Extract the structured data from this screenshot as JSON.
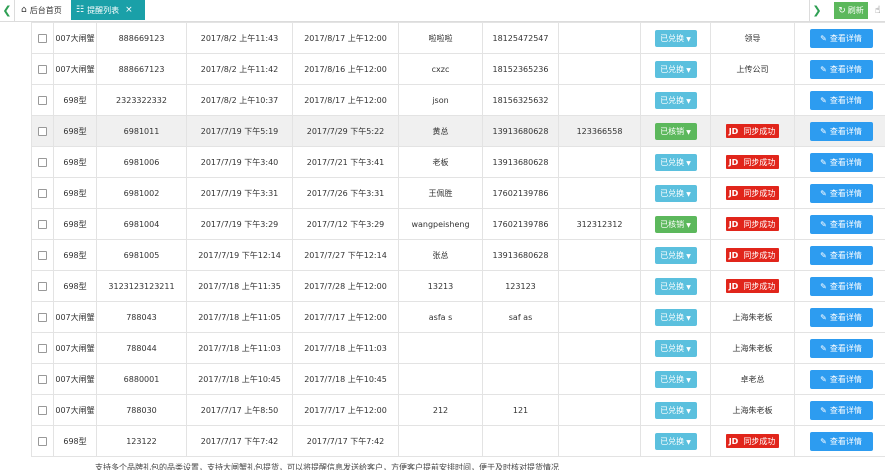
{
  "tabs": {
    "home_label": "后台首页",
    "active_label": "提醒列表",
    "close_glyph": "×",
    "prev_glyph": "❮",
    "next_glyph": "❯"
  },
  "toolbar": {
    "refresh_label": "刷新"
  },
  "status_labels": {
    "exchanged": "已兑换",
    "verified": "已核销"
  },
  "jd_badge": {
    "logo": "JD",
    "text": "同步成功"
  },
  "detail_label": "查看详情",
  "colors": {
    "accent": "#1aa0a8",
    "refresh": "#5cb85c",
    "status_blue": "#5bc0de",
    "status_green": "#5cb85c",
    "detail_blue": "#2d9cf0",
    "jd_red": "#e1251b"
  },
  "icons": {
    "home": "home-icon",
    "tab": "list-icon",
    "refresh": "refresh-icon",
    "edit": "pencil-icon",
    "side": "hand-icon"
  },
  "rows": [
    {
      "type": "007大闸蟹",
      "code": "888669123",
      "created": "2017/8/2 上午11:43",
      "remind": "2017/8/17 上午12:00",
      "name": "啦啦啦",
      "phone": "18125472547",
      "extra": "",
      "status": "已兑换",
      "note": "领导",
      "jd": false,
      "green": false
    },
    {
      "type": "007大闸蟹",
      "code": "888667123",
      "created": "2017/8/2 上午11:42",
      "remind": "2017/8/16 上午12:00",
      "name": "cxzc",
      "phone": "18152365236",
      "extra": "",
      "status": "已兑换",
      "note": "上传公司",
      "jd": false,
      "green": false
    },
    {
      "type": "698型",
      "code": "2323322332",
      "created": "2017/8/2 上午10:37",
      "remind": "2017/8/17 上午12:00",
      "name": "json",
      "phone": "18156325632",
      "extra": "",
      "status": "已兑换",
      "note": "",
      "jd": false,
      "green": false
    },
    {
      "type": "698型",
      "code": "6981011",
      "created": "2017/7/19 下午5:19",
      "remind": "2017/7/29 下午5:22",
      "name": "黄总",
      "phone": "13913680628",
      "extra": "123366558",
      "status": "已核销",
      "note": "",
      "jd": true,
      "green": true,
      "highlight": true
    },
    {
      "type": "698型",
      "code": "6981006",
      "created": "2017/7/19 下午3:40",
      "remind": "2017/7/21 下午3:41",
      "name": "老板",
      "phone": "13913680628",
      "extra": "",
      "status": "已兑换",
      "note": "",
      "jd": true,
      "green": false
    },
    {
      "type": "698型",
      "code": "6981002",
      "created": "2017/7/19 下午3:31",
      "remind": "2017/7/26 下午3:31",
      "name": "王佩胜",
      "phone": "17602139786",
      "extra": "",
      "status": "已兑换",
      "note": "",
      "jd": true,
      "green": false
    },
    {
      "type": "698型",
      "code": "6981004",
      "created": "2017/7/19 下午3:29",
      "remind": "2017/7/12 下午3:29",
      "name": "wangpeisheng",
      "phone": "17602139786",
      "extra": "312312312",
      "status": "已核销",
      "note": "",
      "jd": true,
      "green": true
    },
    {
      "type": "698型",
      "code": "6981005",
      "created": "2017/7/19 下午12:14",
      "remind": "2017/7/27 下午12:14",
      "name": "张总",
      "phone": "13913680628",
      "extra": "",
      "status": "已兑换",
      "note": "",
      "jd": true,
      "green": false
    },
    {
      "type": "698型",
      "code": "3123123123211",
      "created": "2017/7/18 上午11:35",
      "remind": "2017/7/28 上午12:00",
      "name": "13213",
      "phone": "123123",
      "extra": "",
      "status": "已兑换",
      "note": "",
      "jd": true,
      "green": false
    },
    {
      "type": "007大闸蟹",
      "code": "788043",
      "created": "2017/7/18 上午11:05",
      "remind": "2017/7/17 上午12:00",
      "name": "asfa s",
      "phone": "saf as",
      "extra": "",
      "status": "已兑换",
      "note": "上海朱老板",
      "jd": false,
      "green": false
    },
    {
      "type": "007大闸蟹",
      "code": "788044",
      "created": "2017/7/18 上午11:03",
      "remind": "2017/7/18 上午11:03",
      "name": "",
      "phone": "",
      "extra": "",
      "status": "已兑换",
      "note": "上海朱老板",
      "jd": false,
      "green": false
    },
    {
      "type": "007大闸蟹",
      "code": "6880001",
      "created": "2017/7/18 上午10:45",
      "remind": "2017/7/18 上午10:45",
      "name": "",
      "phone": "",
      "extra": "",
      "status": "已兑换",
      "note": "卓老总",
      "jd": false,
      "green": false
    },
    {
      "type": "007大闸蟹",
      "code": "788030",
      "created": "2017/7/17 上午8:50",
      "remind": "2017/7/17 上午12:00",
      "name": "212",
      "phone": "121",
      "extra": "",
      "status": "已兑换",
      "note": "上海朱老板",
      "jd": false,
      "green": false
    },
    {
      "type": "698型",
      "code": "123122",
      "created": "2017/7/17 下午7:42",
      "remind": "2017/7/17 下午7:42",
      "name": "",
      "phone": "",
      "extra": "",
      "status": "已兑换",
      "note": "",
      "jd": true,
      "green": false
    }
  ],
  "footer_text": "支持多个品牌礼包的品类设置，支持大闸蟹礼包提货，可以将提醒信息发送给客户，方便客户提前安排时间，便于及时核对提货情况"
}
